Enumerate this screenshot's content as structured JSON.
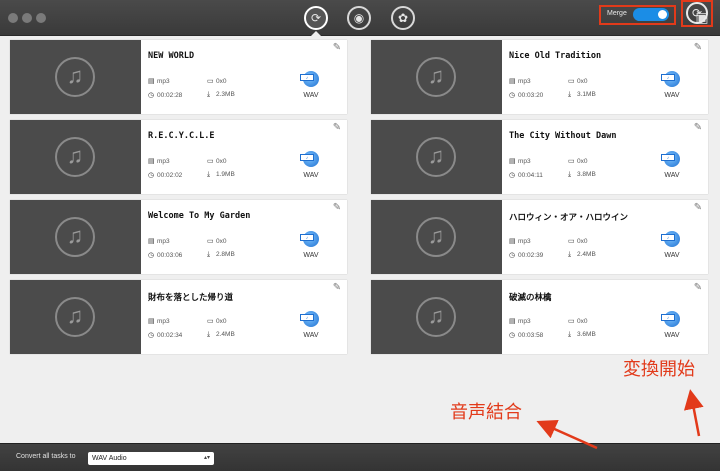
{
  "toolbar": {
    "modes": [
      {
        "icon": "convert-icon",
        "active": true
      },
      {
        "icon": "burn-icon",
        "active": false
      },
      {
        "icon": "toolbox-icon",
        "active": false
      }
    ],
    "right_icon": "media-library-icon"
  },
  "tasks": [
    {
      "title": "NEW WORLD",
      "format": "mp3",
      "resolution": "0x0",
      "duration": "00:02:28",
      "size": "2.3MB",
      "target": "WAV"
    },
    {
      "title": "Nice Old Tradition",
      "format": "mp3",
      "resolution": "0x0",
      "duration": "00:03:20",
      "size": "3.1MB",
      "target": "WAV"
    },
    {
      "title": "R.E.C.Y.C.L.E",
      "format": "mp3",
      "resolution": "0x0",
      "duration": "00:02:02",
      "size": "1.9MB",
      "target": "WAV"
    },
    {
      "title": "The City Without Dawn",
      "format": "mp3",
      "resolution": "0x0",
      "duration": "00:04:11",
      "size": "3.8MB",
      "target": "WAV"
    },
    {
      "title": "Welcome To My Garden",
      "format": "mp3",
      "resolution": "0x0",
      "duration": "00:03:06",
      "size": "2.8MB",
      "target": "WAV"
    },
    {
      "title": "ハロウィン・オア・ハロウイン",
      "format": "mp3",
      "resolution": "0x0",
      "duration": "00:02:39",
      "size": "2.4MB",
      "target": "WAV"
    },
    {
      "title": "財布を落とした帰り道",
      "format": "mp3",
      "resolution": "0x0",
      "duration": "00:02:34",
      "size": "2.4MB",
      "target": "WAV"
    },
    {
      "title": "破滅の林檎",
      "format": "mp3",
      "resolution": "0x0",
      "duration": "00:03:58",
      "size": "3.6MB",
      "target": "WAV"
    }
  ],
  "footer": {
    "convert_all_label": "Convert all tasks to",
    "format_value": "WAV Audio",
    "merge_label": "Merge",
    "merge_on": true
  },
  "annotations": {
    "start_conversion": "変換開始",
    "merge_audio": "音声結合",
    "highlight_color": "#e23a1a"
  }
}
